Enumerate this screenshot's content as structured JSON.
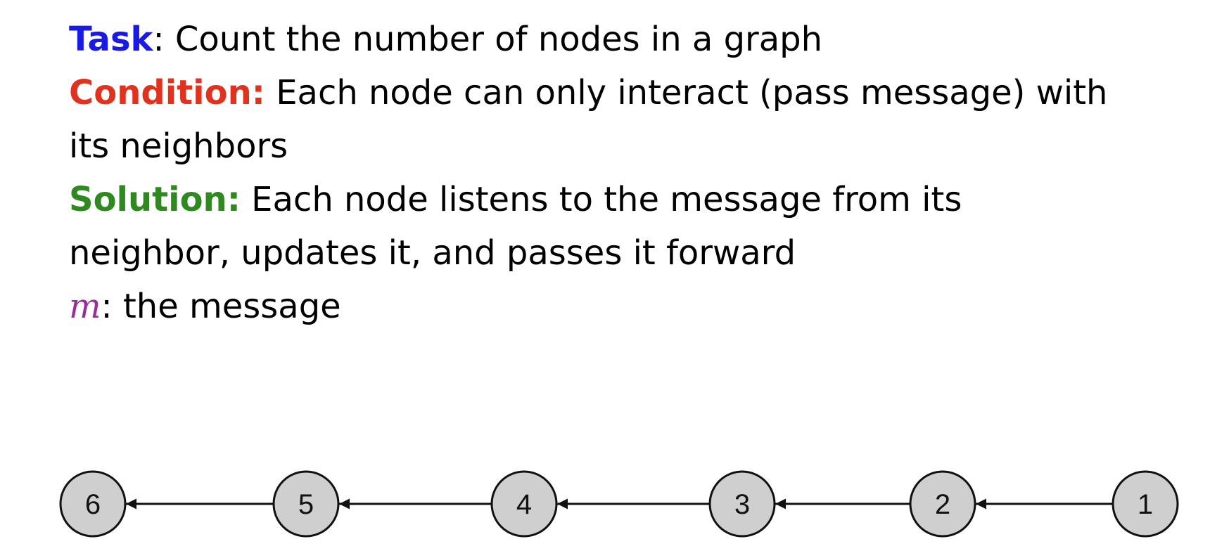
{
  "definitions": {
    "task": {
      "keyword": "Task",
      "text": ": Count the number of nodes in a graph"
    },
    "condition": {
      "keyword": "Condition:",
      "text_line1": " Each node can only interact (pass message) with",
      "text_line2": "its neighbors"
    },
    "solution": {
      "keyword": "Solution:",
      "text_line1": " Each node listens to the message from its",
      "text_line2": "neighbor, updates it, and passes it forward"
    },
    "message": {
      "symbol": "m",
      "text": ": the message"
    }
  },
  "colors": {
    "task": "#1a1ae6",
    "condition": "#e0321f",
    "solution": "#2e8a1f",
    "message_symbol": "#9b2c9b",
    "node_fill": "#cfcfcf",
    "node_stroke": "#111111"
  },
  "graph": {
    "nodes": [
      "6",
      "5",
      "4",
      "3",
      "2",
      "1"
    ],
    "edges": [
      {
        "from": "1",
        "to": "2"
      },
      {
        "from": "2",
        "to": "3"
      },
      {
        "from": "3",
        "to": "4"
      },
      {
        "from": "4",
        "to": "5"
      },
      {
        "from": "5",
        "to": "6"
      }
    ],
    "arrow_direction": "leftward"
  }
}
